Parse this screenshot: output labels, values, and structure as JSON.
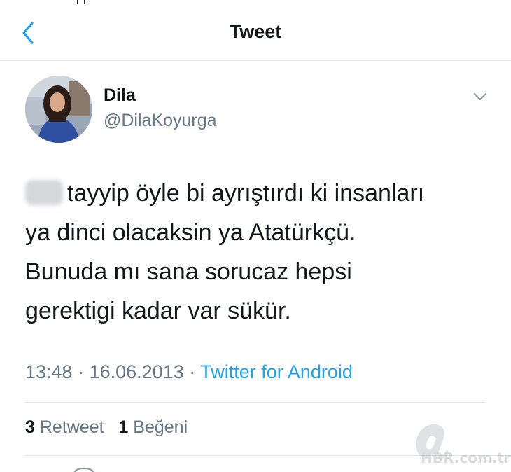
{
  "header": {
    "title": "Tweet"
  },
  "tweet": {
    "name": "Dila",
    "handle": "@DilaKoyurga",
    "text_lines": [
      "tayyip öyle bi ayrıştırdı ki insanları",
      "ya dinci olacaksin ya Atatürkçü.",
      "Bunuda mı sana sorucaz hepsi",
      "gerektigi kadar var sükür."
    ],
    "time": "13:48",
    "date": "16.06.2013",
    "separator": "·",
    "source": "Twitter for Android"
  },
  "stats": {
    "retweets_count": "3",
    "retweets_label": "Retweet",
    "likes_count": "1",
    "likes_label": "Beğeni"
  },
  "watermark": {
    "text": "HBR.com.tr"
  },
  "colors": {
    "accent": "#1da1f2",
    "text": "#14171a",
    "secondary": "#657786",
    "divider": "#e1e4e8"
  },
  "icons": {
    "back": "chevron-left-icon",
    "menu": "chevron-down-icon"
  }
}
